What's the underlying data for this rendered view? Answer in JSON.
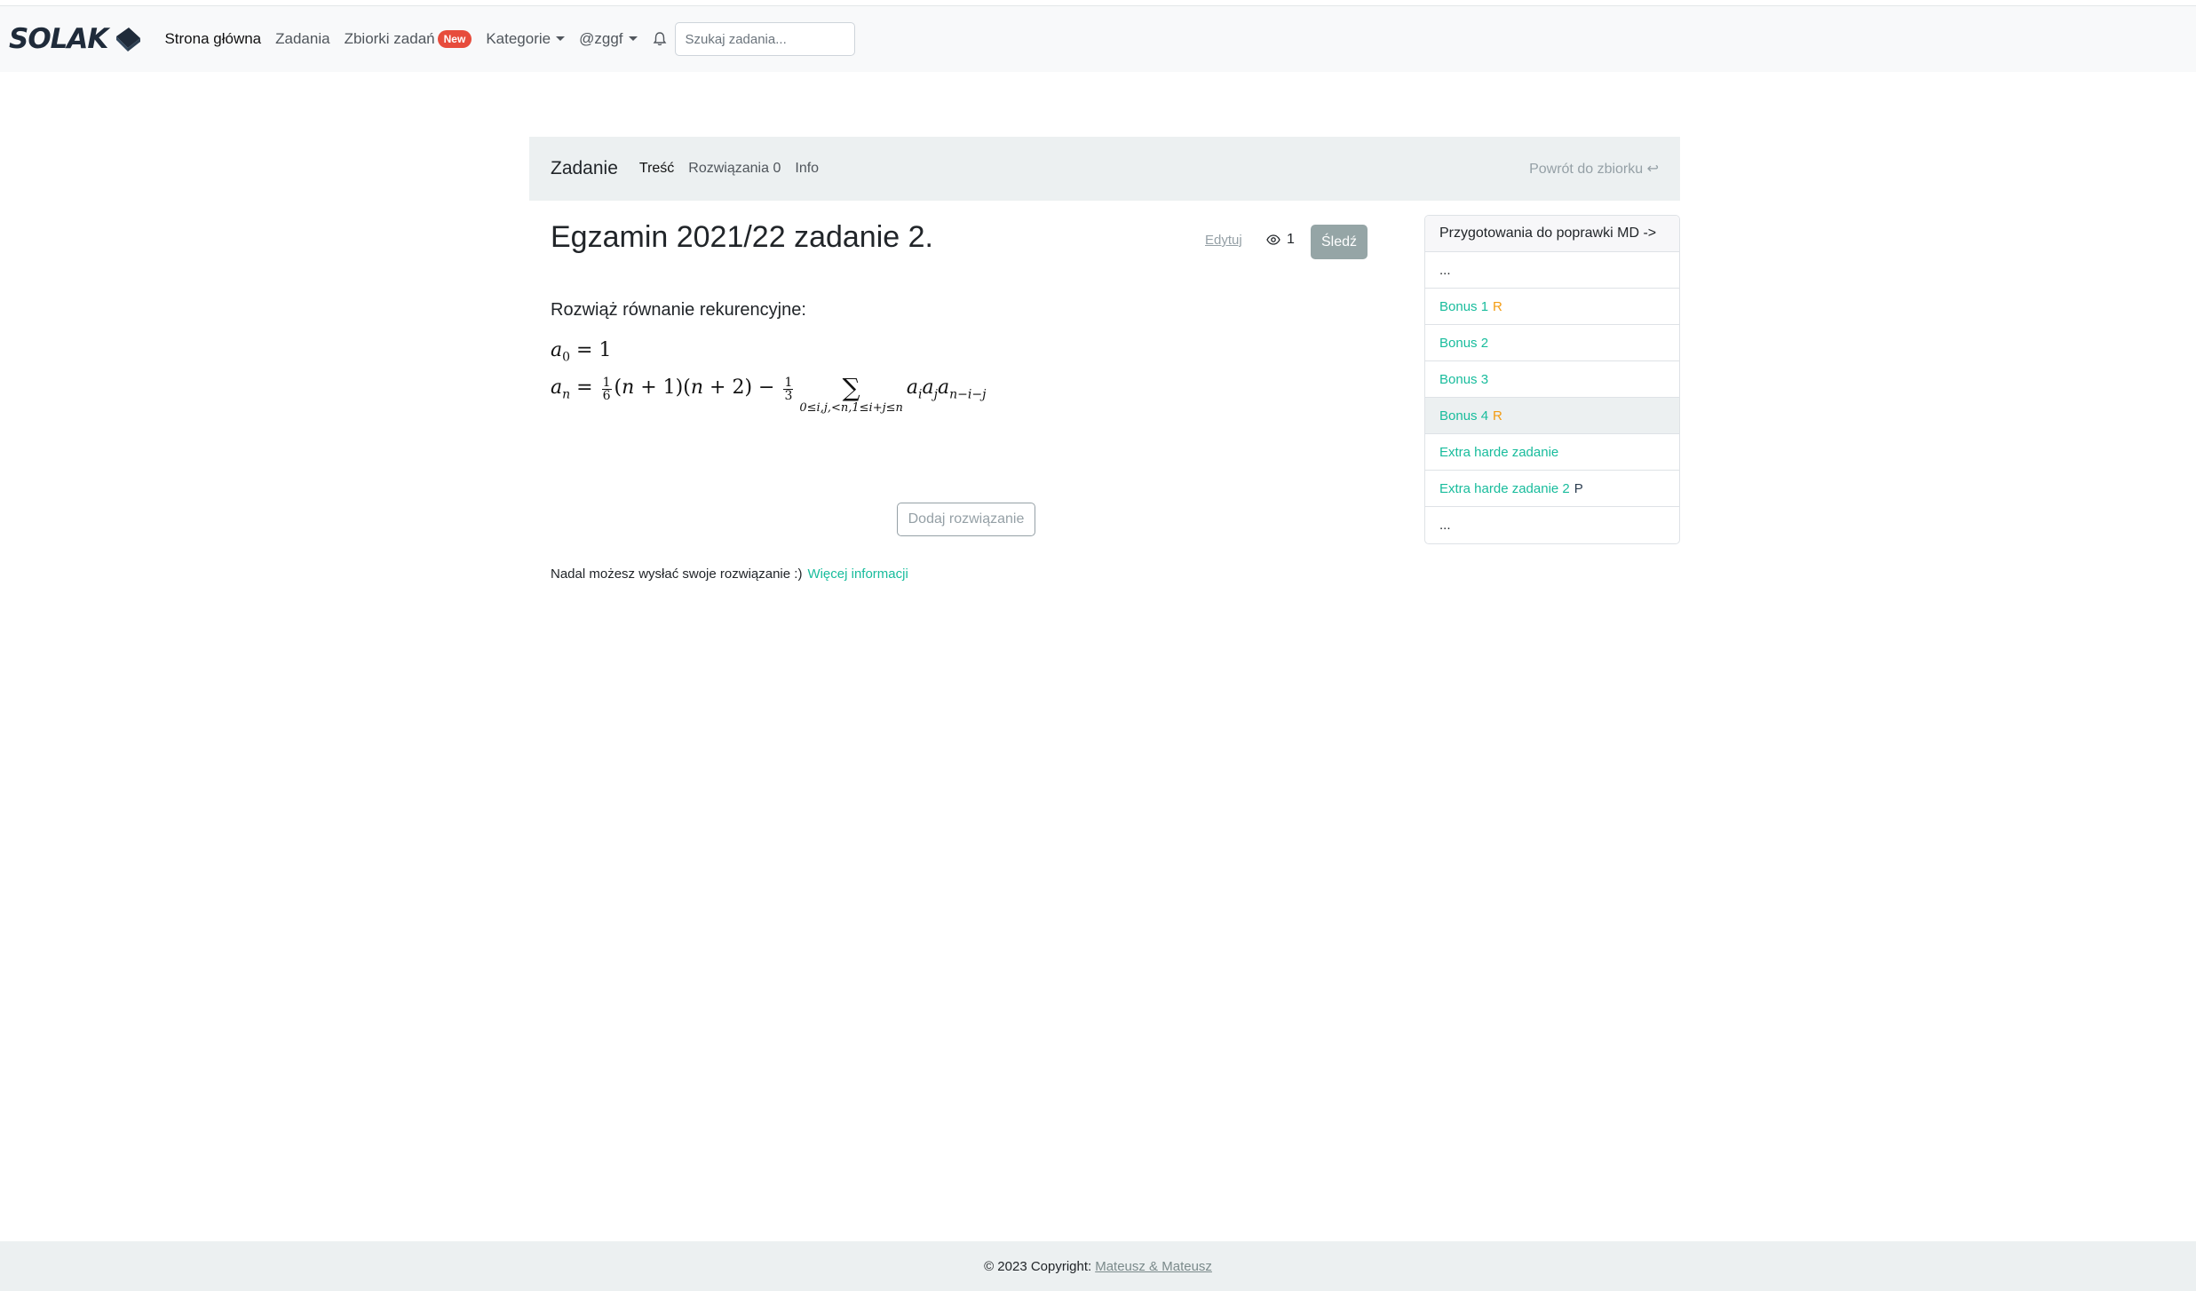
{
  "navbar": {
    "brand": "SOLAK",
    "links": {
      "home": "Strona główna",
      "tasks": "Zadania",
      "collections": "Zbiorki zadań",
      "collections_badge": "New",
      "categories": "Kategorie",
      "user": "@zggf"
    },
    "search_placeholder": "Szukaj zadania..."
  },
  "task_bar": {
    "title": "Zadanie",
    "tabs": {
      "content": "Treść",
      "solutions": "Rozwiązania",
      "solutions_count": "0",
      "info": "Info"
    },
    "back_label": "Powrót do zbiorku ↩"
  },
  "task": {
    "title": "Egzamin 2021/22 zadanie 2.",
    "edit_label": "Edytuj",
    "views_count": "1",
    "follow_label": "Śledź",
    "statement": "Rozwiąż równanie rekurencyjne:",
    "add_solution_label": "Dodaj rozwiązanie",
    "notice_text": "Nadal możesz wysłać swoje rozwiązanie :)",
    "notice_link": "Więcej informacji"
  },
  "sidebar": {
    "header": "Przygotowania do poprawki MD ->",
    "items": [
      {
        "label": "...",
        "mark": ""
      },
      {
        "label": "Bonus 1",
        "mark": "R"
      },
      {
        "label": "Bonus 2",
        "mark": ""
      },
      {
        "label": "Bonus 3",
        "mark": ""
      },
      {
        "label": "Bonus 4",
        "mark": "R"
      },
      {
        "label": "Extra harde zadanie",
        "mark": ""
      },
      {
        "label": "Extra harde zadanie 2",
        "mark": "P"
      },
      {
        "label": "...",
        "mark": ""
      }
    ]
  },
  "footer": {
    "copyright": "© 2023 Copyright:",
    "authors": "Mateusz & Mateusz"
  },
  "colors": {
    "accent": "#18bc9c",
    "badge": "#e74c3c",
    "mark_r": "#f39c12",
    "follow_button": "#95a5a6",
    "bar_background": "#ecf0f1"
  }
}
